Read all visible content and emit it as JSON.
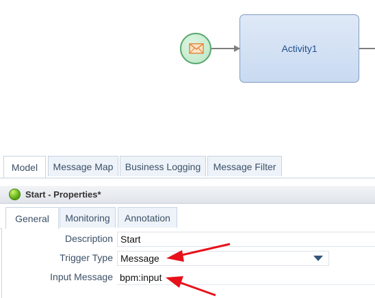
{
  "canvas": {
    "activity_label": "Activity1"
  },
  "editor_tabs": [
    {
      "label": "Model"
    },
    {
      "label": "Message Map"
    },
    {
      "label": "Business Logging"
    },
    {
      "label": "Message Filter"
    }
  ],
  "properties": {
    "title": "Start - Properties*",
    "tabs": [
      {
        "label": "General"
      },
      {
        "label": "Monitoring"
      },
      {
        "label": "Annotation"
      }
    ],
    "fields": {
      "description": {
        "label": "Description",
        "value": "Start"
      },
      "trigger_type": {
        "label": "Trigger Type",
        "value": "Message"
      },
      "input_message": {
        "label": "Input Message",
        "value": "bpm:input"
      }
    }
  },
  "colors": {
    "annotation_arrow": "#e8101a",
    "start_event_border": "#5aa86e",
    "activity_fill": "#c9daf1"
  },
  "icons": {
    "start_event": "envelope-icon",
    "status": "green-dot-icon",
    "dropdown": "chevron-down-icon"
  }
}
